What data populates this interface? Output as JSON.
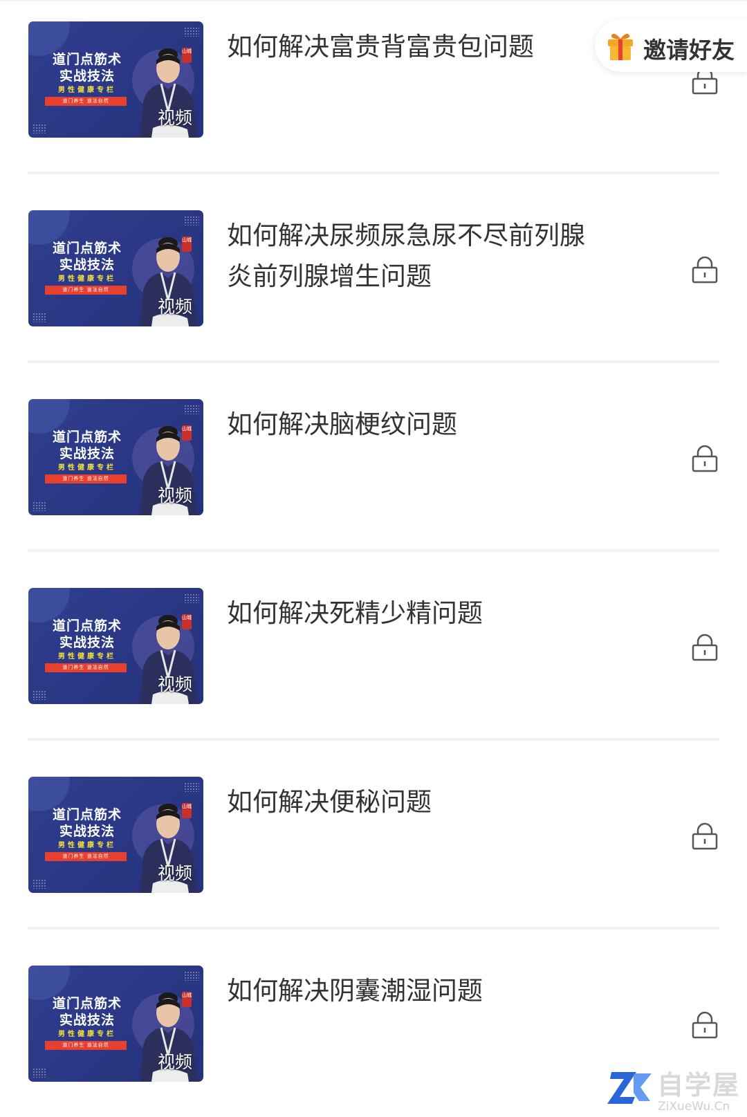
{
  "invite": {
    "label": "邀请好友",
    "icon": "gift-icon"
  },
  "thumbnail": {
    "title_line1": "道门点筋术",
    "title_line2": "实战技法",
    "subtitle": "男性健康专栏",
    "banner": "道门养生 道法自然",
    "seal": "山城",
    "type_label": "视频"
  },
  "courses": [
    {
      "title": "如何解决富贵背富贵包问题",
      "locked": true
    },
    {
      "title": "如何解决尿频尿急尿不尽前列腺炎前列腺增生问题",
      "locked": true
    },
    {
      "title": "如何解决脑梗纹问题",
      "locked": true
    },
    {
      "title": "如何解决死精少精问题",
      "locked": true
    },
    {
      "title": "如何解决便秘问题",
      "locked": true
    },
    {
      "title": "如何解决阴囊潮湿问题",
      "locked": true
    }
  ],
  "watermark": {
    "name": "自学屋",
    "url": "ZiXueWu.Cn"
  },
  "colors": {
    "thumbnail_bg": "#2f3e8f",
    "accent_red": "#e8402f",
    "accent_yellow": "#f7e03c",
    "gift_orange": "#f5a623",
    "title_text": "#333333",
    "divider": "#f3f3f3",
    "watermark_blue": "#2a66d8"
  }
}
